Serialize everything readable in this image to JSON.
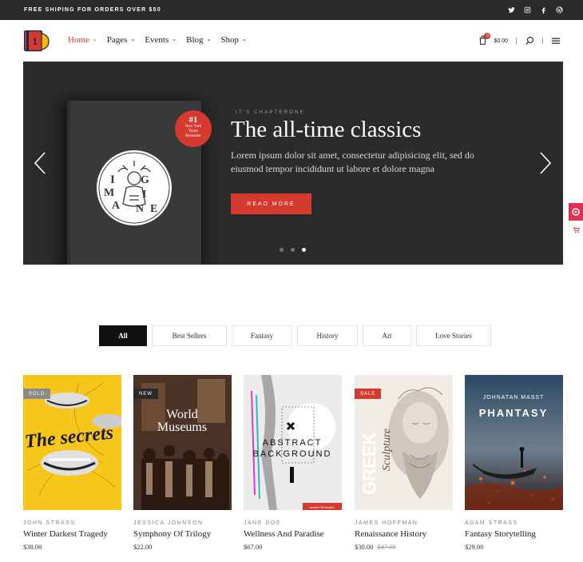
{
  "topbar": {
    "promo": "FREE SHIPING FOR ORDERS OVER $50",
    "socials": [
      "twitter-icon",
      "instagram-icon",
      "facebook-icon",
      "dribbble-icon"
    ]
  },
  "header": {
    "nav": [
      {
        "label": "Home",
        "active": true
      },
      {
        "label": "Pages",
        "active": false
      },
      {
        "label": "Events",
        "active": false
      },
      {
        "label": "Blog",
        "active": false
      },
      {
        "label": "Shop",
        "active": false
      }
    ],
    "cart_count": "0",
    "cart_total": "$0.00"
  },
  "hero": {
    "badge_number": "#1",
    "badge_line1": "New York",
    "badge_line2": "Times",
    "badge_line3": "Bestseller",
    "eyebrow": "IT'S CHAPTERONE",
    "title": "The all-time classics",
    "description": "Lorem ipsum dolor sit amet, consectetur adipisicing elit, sed do eiusmod tempor incididunt ut labore et dolore magna",
    "button": "READ MORE",
    "slides": 3,
    "active_slide": 3
  },
  "filters": [
    "All",
    "Best Sellers",
    "Fantasy",
    "History",
    "Art",
    "Love Stories"
  ],
  "active_filter": "All",
  "products": [
    {
      "author": "JOHN STRASS",
      "title": "Winter Darkest Tragedy",
      "price": "$38.00",
      "old_price": "",
      "tag": "SOLD",
      "cover_text": "The secrets"
    },
    {
      "author": "JESSICA JOHNSON",
      "title": "Symphony Of Trilogy",
      "price": "$22.00",
      "old_price": "",
      "tag": "NEW",
      "cover_text": "World Museums"
    },
    {
      "author": "JANE DOE",
      "title": "Wellness And Paradise",
      "price": "$67.00",
      "old_price": "",
      "tag": "",
      "cover_text": "ABSTRACT BACKGROUND",
      "cover_sub": "James Hill Burton"
    },
    {
      "author": "JAMES HOFFMAN",
      "title": "Renaissance History",
      "price": "$30.00",
      "old_price": "$47.00",
      "tag": "SALE",
      "cover_text": "GREEK",
      "cover_sub": "Sculpture"
    },
    {
      "author": "ADAM STRASS",
      "title": "Fantasy Storytelling",
      "price": "$29.00",
      "old_price": "",
      "tag": "",
      "cover_author": "JOHNATAN MASST",
      "cover_text": "PHANTASY"
    }
  ],
  "colors": {
    "accent": "#d53a2f",
    "dark": "#2b2b2b",
    "widget": "#e62e53"
  }
}
